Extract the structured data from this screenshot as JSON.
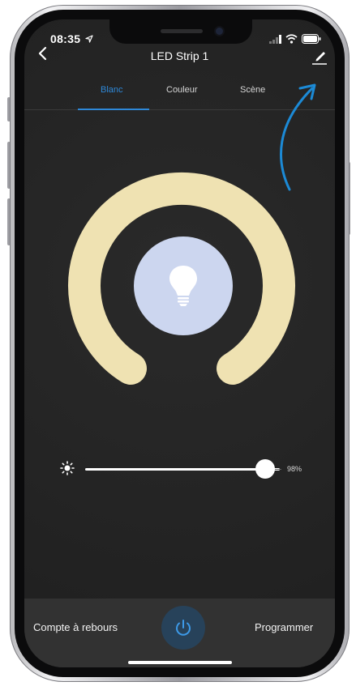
{
  "status_bar": {
    "time": "08:35"
  },
  "header": {
    "title": "LED Strip 1"
  },
  "tabs": [
    {
      "label": "Blanc",
      "active": true
    },
    {
      "label": "Couleur",
      "active": false
    },
    {
      "label": "Scène",
      "active": false
    }
  ],
  "colors": {
    "accent": "#2e88d8",
    "ring": "#efe2b2",
    "bulb_bg": "#ccd6ef",
    "annotation_arrow": "#1c8ad6"
  },
  "brightness": {
    "value_label": "98%",
    "value": 0.98
  },
  "footer": {
    "timer_label": "Compte à rebours",
    "schedule_label": "Programmer"
  },
  "icons": {
    "back": "chevron-left-icon",
    "edit": "pencil-icon",
    "bulb": "lightbulb-icon",
    "brightness": "sun-icon",
    "power": "power-icon"
  }
}
